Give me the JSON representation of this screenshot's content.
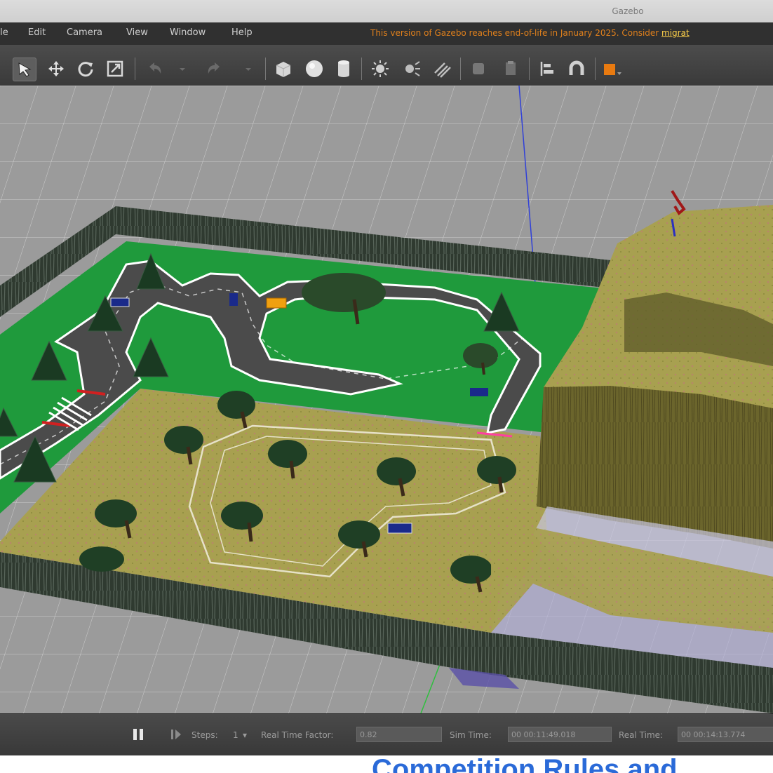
{
  "window": {
    "title": "Gazebo"
  },
  "menu": {
    "items": [
      "File",
      "Edit",
      "Camera",
      "View",
      "Window",
      "Help"
    ],
    "notice": "This version of Gazebo reaches end-of-life in January 2025. Consider ",
    "notice_link": "migrat"
  },
  "toolbar": {
    "icons": [
      "select-arrow-icon",
      "translate-icon",
      "rotate-icon",
      "scale-icon",
      "undo-icon",
      "redo-icon",
      "box-icon",
      "sphere-icon",
      "cylinder-icon",
      "point-light-icon",
      "spot-light-icon",
      "directional-light-icon",
      "copy-icon",
      "paste-icon",
      "align-icon",
      "snap-icon",
      "change-view-icon"
    ]
  },
  "bottom": {
    "steps_label": "Steps:",
    "steps_value": "1",
    "rtf_label": "Real Time Factor:",
    "rtf_value": "0.82",
    "sim_time_label": "Sim Time:",
    "sim_time_value": "00 00:11:49.018",
    "real_time_label": "Real Time:",
    "real_time_value": "00 00:14:13.774"
  },
  "footer": {
    "heading": "Competition Rules and"
  },
  "colors": {
    "grass": "#1f9a3c",
    "track": "#4b4b4b",
    "terrain": "#a8a050",
    "wall": "#2f3a30",
    "accent_notice": "#e0801c",
    "footer_text": "#2a6ad8"
  }
}
